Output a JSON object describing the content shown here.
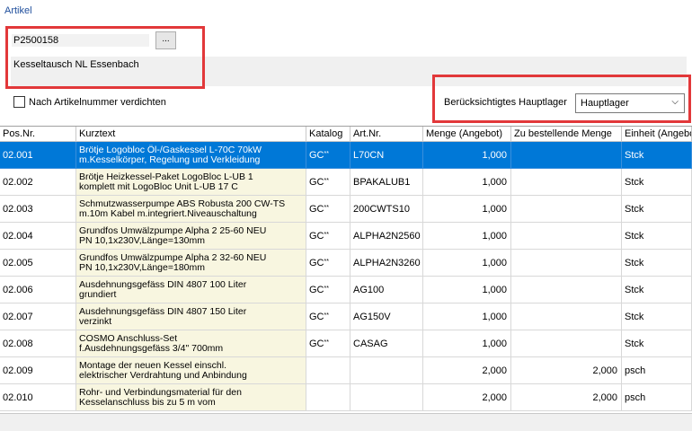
{
  "group_label": "Artikel",
  "article_number": "P2500158",
  "browse_label": "...",
  "article_description": "Kesseltausch NL Essenbach",
  "compress_checkbox_label": "Nach Artikelnummer verdichten",
  "compress_checked": false,
  "warehouse_label": "Berücksichtigtes Hauptlager",
  "warehouse_value": "Hauptlager",
  "colors": {
    "highlight_box": "#e2383a",
    "selection": "#0078d7",
    "kurztext_bg": "#f8f6e0",
    "group_label": "#1f4e9c"
  },
  "columns": [
    "Pos.Nr.",
    "Kurztext",
    "Katalog",
    "Art.Nr.",
    "Menge (Angebot)",
    "Zu bestellende Menge",
    "Einheit (Angebo"
  ],
  "rows": [
    {
      "pos": "02.001",
      "kurz1": "Brötje Logobloc Öl-/Gaskessel L-70C 70kW",
      "kurz2": "m.Kesselkörper, Regelung und Verkleidung",
      "katalog": "GC",
      "katalog_sup": "**",
      "artnr": "L70CN",
      "menge": "1,000",
      "bestellen": "",
      "einheit": "Stck"
    },
    {
      "pos": "02.002",
      "kurz1": "Brötje Heizkessel-Paket LogoBloc L-UB 1",
      "kurz2": "komplett mit LogoBloc Unit L-UB 17 C",
      "katalog": "GC",
      "katalog_sup": "**",
      "artnr": "BPAKALUB1",
      "menge": "1,000",
      "bestellen": "",
      "einheit": "Stck"
    },
    {
      "pos": "02.003",
      "kurz1": "Schmutzwasserpumpe ABS Robusta 200 CW-TS",
      "kurz2": "m.10m Kabel m.integriert.Niveauschaltung",
      "katalog": "GC",
      "katalog_sup": "**",
      "artnr": "200CWTS10",
      "menge": "1,000",
      "bestellen": "",
      "einheit": "Stck"
    },
    {
      "pos": "02.004",
      "kurz1": "Grundfos Umwälzpumpe Alpha 2 25-60 NEU",
      "kurz2": "PN 10,1x230V,Länge=130mm",
      "katalog": "GC",
      "katalog_sup": "**",
      "artnr": "ALPHA2N2560",
      "menge": "1,000",
      "bestellen": "",
      "einheit": "Stck"
    },
    {
      "pos": "02.005",
      "kurz1": "Grundfos Umwälzpumpe Alpha 2 32-60 NEU",
      "kurz2": "PN 10,1x230V,Länge=180mm",
      "katalog": "GC",
      "katalog_sup": "**",
      "artnr": "ALPHA2N3260",
      "menge": "1,000",
      "bestellen": "",
      "einheit": "Stck"
    },
    {
      "pos": "02.006",
      "kurz1": "Ausdehnungsgefäss DIN 4807 100 Liter",
      "kurz2": "grundiert",
      "katalog": "GC",
      "katalog_sup": "**",
      "artnr": "AG100",
      "menge": "1,000",
      "bestellen": "",
      "einheit": "Stck"
    },
    {
      "pos": "02.007",
      "kurz1": "Ausdehnungsgefäss DIN 4807 150 Liter",
      "kurz2": "verzinkt",
      "katalog": "GC",
      "katalog_sup": "**",
      "artnr": "AG150V",
      "menge": "1,000",
      "bestellen": "",
      "einheit": "Stck"
    },
    {
      "pos": "02.008",
      "kurz1": "COSMO Anschluss-Set",
      "kurz2": "f.Ausdehnungsgefäss 3/4\" 700mm",
      "katalog": "GC",
      "katalog_sup": "**",
      "artnr": "CASAG",
      "menge": "1,000",
      "bestellen": "",
      "einheit": "Stck"
    },
    {
      "pos": "02.009",
      "kurz1": "Montage der neuen Kessel einschl.",
      "kurz2": "elektrischer Verdrahtung und Anbindung",
      "katalog": "",
      "katalog_sup": "",
      "artnr": "",
      "menge": "2,000",
      "bestellen": "2,000",
      "einheit": "psch"
    },
    {
      "pos": "02.010",
      "kurz1": "Rohr- und Verbindungsmaterial für den",
      "kurz2": "Kesselanschluss bis zu 5 m vom",
      "katalog": "",
      "katalog_sup": "",
      "artnr": "",
      "menge": "2,000",
      "bestellen": "2,000",
      "einheit": "psch"
    }
  ]
}
